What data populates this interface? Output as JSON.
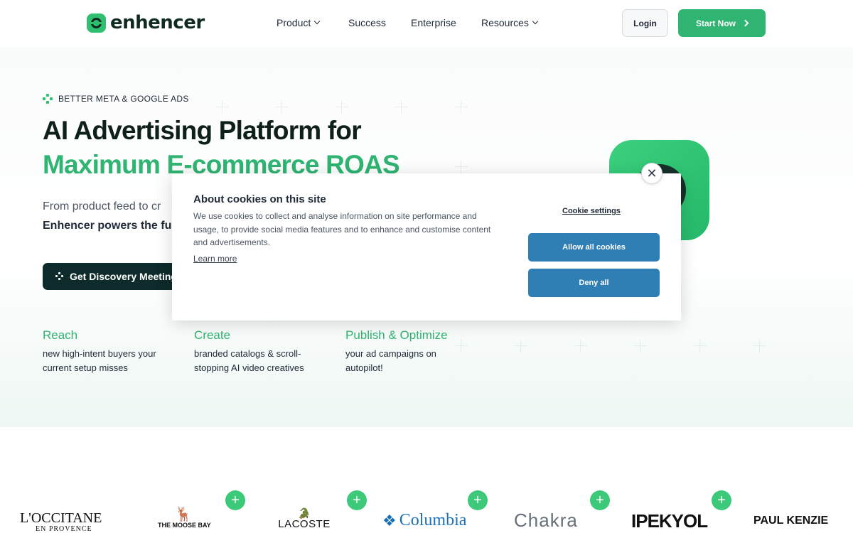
{
  "header": {
    "logo_text": "enhencer",
    "nav": [
      {
        "label": "Product"
      },
      {
        "label": "Success"
      },
      {
        "label": "Enterprise"
      },
      {
        "label": "Resources"
      }
    ],
    "login_label": "Login",
    "start_label": "Start Now"
  },
  "hero": {
    "eyebrow": "BETTER META & GOOGLE ADS",
    "title_line1": "AI Advertising Platform for",
    "title_line2": "Maximum E-commerce ROAS",
    "subtitle_line1": "From product feed to cr",
    "subtitle_line2": "Enhencer powers the fu",
    "cta_label": "Get Discovery Meeting",
    "features": [
      {
        "title": "Reach",
        "line1": "new high-intent buyers your",
        "line2": "current setup misses"
      },
      {
        "title": "Create",
        "line1": "branded catalogs & scroll-",
        "line2": "stopping AI video creatives"
      },
      {
        "title": "Publish & Optimize",
        "line1": "your ad campaigns on",
        "line2": "autopilot!"
      }
    ]
  },
  "cookie_banner": {
    "title": "About cookies on this site",
    "body": "We use cookies to collect and analyse information on site performance and usage, to provide social media features and to enhance and customise content and advertisements.",
    "learn_more": "Learn more",
    "settings_label": "Cookie settings",
    "allow_label": "Allow all cookies",
    "deny_label": "Deny all",
    "close_symbol": "✕",
    "button_color": "#2f7fb5"
  },
  "brands": [
    {
      "name": "L'OCCITANE",
      "sub": "EN PROVENCE"
    },
    {
      "name": "THE MOOSE BAY"
    },
    {
      "name": "LACOSTE"
    },
    {
      "name": "Columbia"
    },
    {
      "name": "Chakra"
    },
    {
      "name": "IPEKYOL"
    },
    {
      "name": "PAUL KENZIE"
    }
  ],
  "colors": {
    "brand_green": "#2fb472",
    "dark": "#0f2a2a"
  }
}
